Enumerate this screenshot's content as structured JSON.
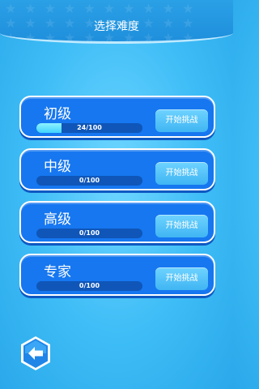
{
  "header": {
    "title": "选择难度"
  },
  "levels": [
    {
      "name": "初级",
      "progress": "24/100",
      "fraction": 0.24,
      "button": "开始挑战"
    },
    {
      "name": "中级",
      "progress": "0/100",
      "fraction": 0,
      "button": "开始挑战"
    },
    {
      "name": "高级",
      "progress": "0/100",
      "fraction": 0,
      "button": "开始挑战"
    },
    {
      "name": "专家",
      "progress": "0/100",
      "fraction": 0,
      "button": "开始挑战"
    }
  ],
  "colors": {
    "background": "#3dbcf6",
    "card": "#1677f0",
    "progress_fill": "#3fd3ff",
    "button": "#4fc0f7"
  },
  "icons": {
    "back": "back-arrow-icon"
  }
}
